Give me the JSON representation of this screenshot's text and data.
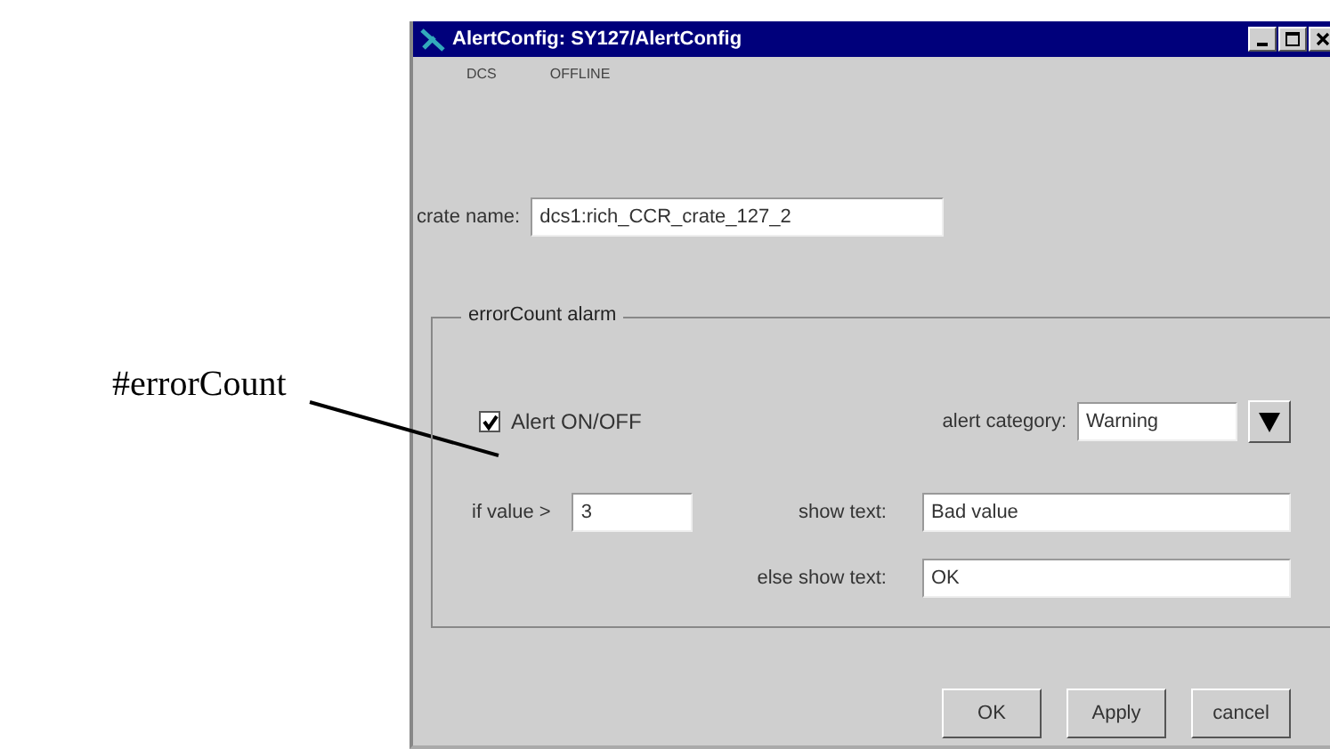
{
  "annotation": {
    "label": "#errorCount"
  },
  "window": {
    "title": "AlertConfig: SY127/AlertConfig"
  },
  "menu": [
    "DCS",
    "OFFLINE"
  ],
  "crate": {
    "label": "crate name:",
    "value": "dcs1:rich_CCR_crate_127_2"
  },
  "group": {
    "title": "errorCount alarm",
    "alert": {
      "label": "Alert ON/OFF",
      "checked": true
    },
    "category": {
      "label": "alert category:",
      "value": "Warning"
    },
    "threshold": {
      "label": "if value >",
      "value": "3"
    },
    "show_text": {
      "label": "show text:",
      "value": "Bad value"
    },
    "else_text": {
      "label": "else show text:",
      "value": "OK"
    }
  },
  "buttons": [
    "OK",
    "Apply",
    "cancel"
  ]
}
